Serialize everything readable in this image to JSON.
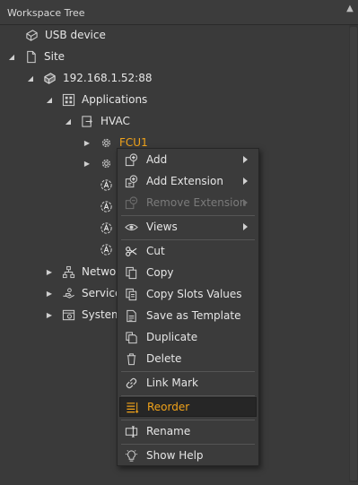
{
  "panel": {
    "title": "Workspace Tree"
  },
  "tree": {
    "usb": "USB device",
    "site": "Site",
    "ip": "192.168.1.52:88",
    "applications": "Applications",
    "hvac": "HVAC",
    "fcu1": "FCU1",
    "networks": "Networ",
    "services": "Service",
    "system": "System"
  },
  "menu": {
    "add": "Add",
    "add_extension": "Add Extension",
    "remove_extension": "Remove Extension",
    "views": "Views",
    "cut": "Cut",
    "copy": "Copy",
    "copy_slots": "Copy Slots Values",
    "save_template": "Save as Template",
    "duplicate": "Duplicate",
    "delete": "Delete",
    "link_mark": "Link Mark",
    "reorder": "Reorder",
    "rename": "Rename",
    "show_help": "Show Help"
  },
  "colors": {
    "accent": "#f1a31a",
    "background": "#3a3a3a",
    "text": "#e6e6e6"
  }
}
